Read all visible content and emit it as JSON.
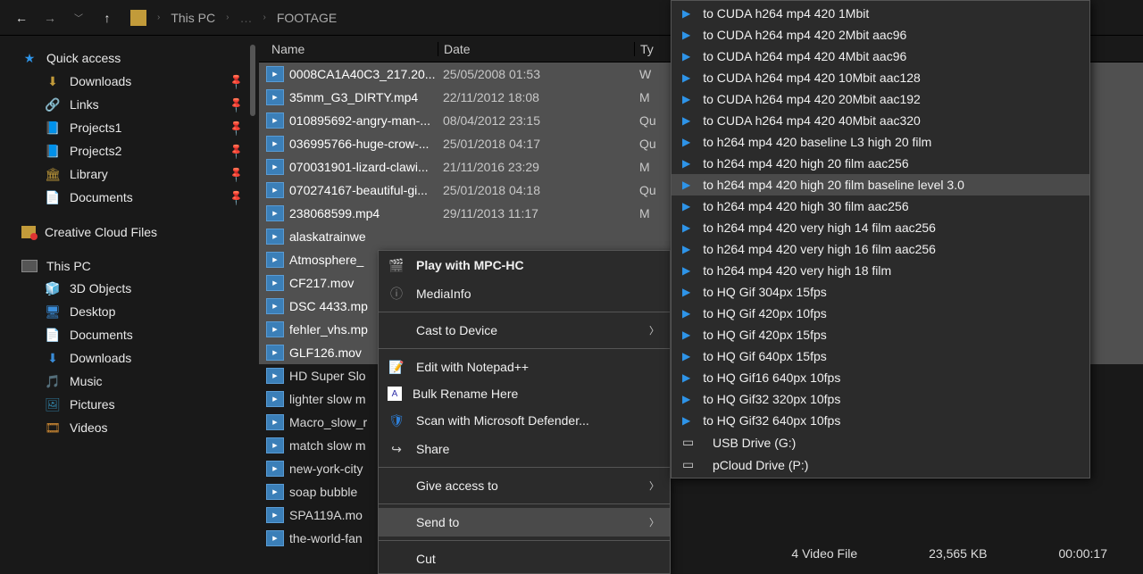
{
  "breadcrumb": {
    "root": "This PC",
    "leaf": "FOOTAGE"
  },
  "sidebar": {
    "quick_access": "Quick access",
    "pins": [
      {
        "label": "Downloads"
      },
      {
        "label": "Links"
      },
      {
        "label": "Projects1"
      },
      {
        "label": "Projects2"
      },
      {
        "label": "Library"
      },
      {
        "label": "Documents"
      }
    ],
    "ccf": "Creative Cloud Files",
    "thispc": "This PC",
    "thispc_children": [
      {
        "label": "3D Objects"
      },
      {
        "label": "Desktop"
      },
      {
        "label": "Documents"
      },
      {
        "label": "Downloads"
      },
      {
        "label": "Music"
      },
      {
        "label": "Pictures"
      },
      {
        "label": "Videos"
      }
    ]
  },
  "columns": {
    "name": "Name",
    "date": "Date",
    "type": "Ty"
  },
  "files": [
    {
      "name": "0008CA1A40C3_217.20...",
      "date": "25/05/2008 01:53",
      "type": "W",
      "sel": true
    },
    {
      "name": "35mm_G3_DIRTY.mp4",
      "date": "22/11/2012 18:08",
      "type": "M",
      "sel": true
    },
    {
      "name": "010895692-angry-man-...",
      "date": "08/04/2012 23:15",
      "type": "Qu",
      "sel": true
    },
    {
      "name": "036995766-huge-crow-...",
      "date": "25/01/2018 04:17",
      "type": "Qu",
      "sel": true
    },
    {
      "name": "070031901-lizard-clawi...",
      "date": "21/11/2016 23:29",
      "type": "M",
      "sel": true
    },
    {
      "name": "070274167-beautiful-gi...",
      "date": "25/01/2018 04:18",
      "type": "Qu",
      "sel": true
    },
    {
      "name": "238068599.mp4",
      "date": "29/11/2013 11:17",
      "type": "M",
      "sel": true
    },
    {
      "name": "alaskatrainwe",
      "date": "",
      "type": "",
      "sel": true
    },
    {
      "name": "Atmosphere_",
      "date": "",
      "type": "",
      "sel": true
    },
    {
      "name": "CF217.mov",
      "date": "",
      "type": "",
      "sel": true
    },
    {
      "name": "DSC 4433.mp",
      "date": "",
      "type": "",
      "sel": true
    },
    {
      "name": "fehler_vhs.mp",
      "date": "",
      "type": "",
      "sel": true
    },
    {
      "name": "GLF126.mov",
      "date": "",
      "type": "",
      "sel": true
    },
    {
      "name": "HD Super Slo",
      "date": "",
      "type": "",
      "sel": false
    },
    {
      "name": "lighter slow m",
      "date": "",
      "type": "",
      "sel": false
    },
    {
      "name": "Macro_slow_r",
      "date": "",
      "type": "",
      "sel": false
    },
    {
      "name": "match slow m",
      "date": "",
      "type": "",
      "sel": false
    },
    {
      "name": "new-york-city",
      "date": "",
      "type": "",
      "sel": false
    },
    {
      "name": "soap bubble",
      "date": "",
      "type": "",
      "sel": false
    },
    {
      "name": "SPA119A.mo",
      "date": "",
      "type": "",
      "sel": false
    },
    {
      "name": "the-world-fan",
      "date": "",
      "type": "",
      "sel": false
    }
  ],
  "ctx1": {
    "play": "Play with MPC-HC",
    "mediainfo": "MediaInfo",
    "cast": "Cast to Device",
    "npp": "Edit with Notepad++",
    "bulk": "Bulk Rename Here",
    "defender": "Scan with Microsoft Defender...",
    "share": "Share",
    "giveaccess": "Give access to",
    "sendto": "Send to",
    "cut": "Cut"
  },
  "ctx2": {
    "items": [
      "to CUDA h264 mp4 420 1Mbit",
      "to CUDA h264 mp4 420 2Mbit aac96",
      "to CUDA h264 mp4 420 4Mbit aac96",
      "to CUDA h264 mp4 420 10Mbit aac128",
      "to CUDA h264 mp4 420 20Mbit aac192",
      "to CUDA h264 mp4 420 40Mbit aac320",
      "to h264 mp4 420 baseline L3 high 20 film",
      "to h264 mp4 420 high 20 film aac256",
      "to h264 mp4 420 high 20 film baseline level 3.0",
      "to h264 mp4 420 high 30 film aac256",
      "to h264 mp4 420 very high 14 film aac256",
      "to h264 mp4 420 very high 16 film aac256",
      "to h264 mp4 420 very high 18 film",
      "to HQ Gif 304px 15fps",
      "to HQ Gif 420px 10fps",
      "to HQ Gif 420px 15fps",
      "to HQ Gif 640px 15fps",
      "to HQ Gif16 640px 10fps",
      "to HQ Gif32 320px 10fps",
      "to HQ Gif32 640px 10fps"
    ],
    "highlight_index": 8,
    "drives": [
      {
        "label": "USB Drive (G:)"
      },
      {
        "label": "pCloud Drive (P:)"
      }
    ]
  },
  "status": {
    "typepart": "4 Video File",
    "size": "23,565 KB",
    "duration": "00:00:17"
  }
}
